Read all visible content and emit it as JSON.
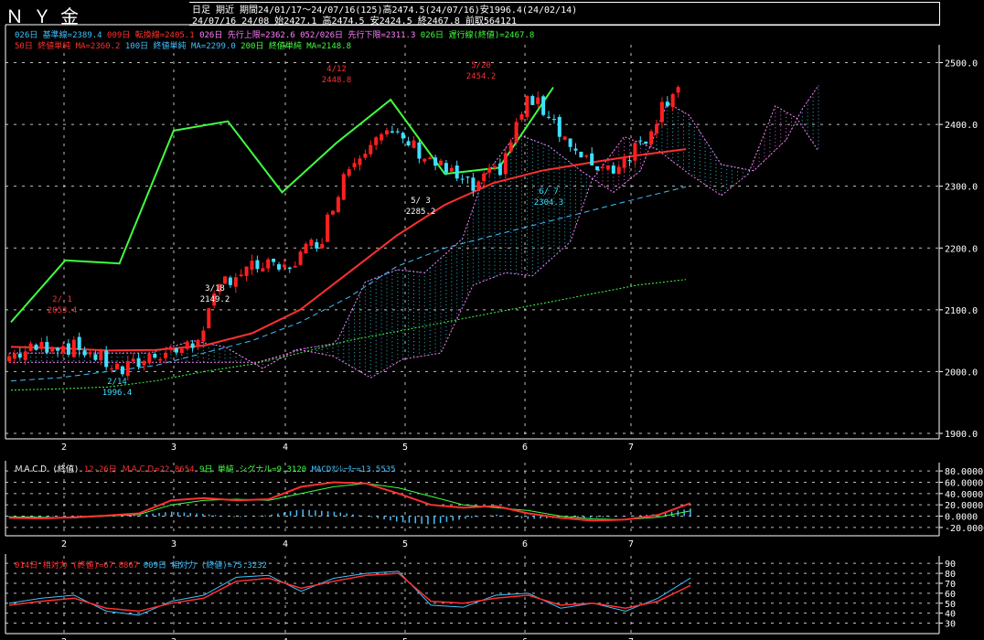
{
  "header": {
    "title": "ＮＹ金",
    "line1": "日足 期近 期間24/01/17～24/07/16(125)高2474.5(24/07/16)安1996.4(24/02/14)",
    "line2": "24/07/16 24/08 始2427.1 高2474.5 安2424.5 終2467.8 前取564121"
  },
  "legend": {
    "row1": [
      {
        "text": "026日 基準線=2389.4",
        "color": "#40c0ff"
      },
      {
        "text": "009日 転換線=2405.1",
        "color": "#ff3030"
      },
      {
        "text": "026日 先行上限=2362.6",
        "color": "#ff80ff"
      },
      {
        "text": "052/026日 先行下限=2311.3",
        "color": "#ff80ff"
      },
      {
        "text": "026日 遅行線(終値)=2467.8",
        "color": "#40ff40"
      }
    ],
    "row2": [
      {
        "text": "50日 終値単純 MA=2360.2",
        "color": "#ff3030"
      },
      {
        "text": "100日 終値単純 MA=2299.0",
        "color": "#40c0ff"
      },
      {
        "text": "200日 終値単純 MA=2148.8",
        "color": "#40ff40"
      }
    ],
    "macd": [
      {
        "text": "ＭＡＣＤ (終値)",
        "color": "#ffffff"
      },
      {
        "text": "12-26日 ＭＡＣＤ=22.8654",
        "color": "#ff3030"
      },
      {
        "text": "9日 単純 シグナル=9.3120",
        "color": "#40ff40"
      },
      {
        "text": "MACDｵｼﾚｰﾀｰ=13.5535",
        "color": "#40c0ff"
      }
    ],
    "rsi": [
      {
        "text": "014日 相対力 (終値)=67.8867",
        "color": "#ff3030"
      },
      {
        "text": "009日 相対力 (終値)=75.3232",
        "color": "#40c0ff"
      }
    ]
  },
  "colors": {
    "up": "#ff2020",
    "down": "#40e0ff",
    "grid": "#ffffff",
    "text": "#ffffff"
  },
  "chart_data": [
    {
      "type": "candlestick",
      "title": "ＮＹ金",
      "x_ticks": [
        "2",
        "3",
        "4",
        "5",
        "6",
        "7"
      ],
      "ylim": [
        1900,
        2520
      ],
      "y_ticks": [
        "1900.0",
        "2000.0",
        "2100.0",
        "2200.0",
        "2300.0",
        "2400.0",
        "2500.0"
      ],
      "grid": true,
      "series": [
        {
          "name": "50日 終値単純 MA",
          "values": [
            2040,
            2038,
            2034,
            2035,
            2042,
            2062,
            2100,
            2160,
            2220,
            2270,
            2305,
            2325,
            2338,
            2350,
            2360
          ]
        },
        {
          "name": "100日 終値単純 MA",
          "values": [
            1985,
            1990,
            2000,
            2010,
            2030,
            2050,
            2080,
            2120,
            2170,
            2200,
            2220,
            2240,
            2260,
            2280,
            2299
          ]
        },
        {
          "name": "200日 終値単純 MA",
          "values": [
            1970,
            1972,
            1975,
            1985,
            2000,
            2012,
            2030,
            2050,
            2065,
            2080,
            2095,
            2110,
            2125,
            2140,
            2149
          ]
        },
        {
          "name": "026日 遅行線(終値)",
          "values": [
            2080,
            2180,
            2175,
            2390,
            2405,
            2290,
            2370,
            2440,
            2320,
            2330,
            2460
          ]
        }
      ],
      "annotations": [
        {
          "label": "2/ 1",
          "value": "2053.4"
        },
        {
          "label": "2/14",
          "value": "1996.4"
        },
        {
          "label": "3/18",
          "value": "2149.2"
        },
        {
          "label": "4/12",
          "value": "2448.8"
        },
        {
          "label": "5/ 3",
          "value": "2285.2"
        },
        {
          "label": "5/20",
          "value": "2454.2"
        },
        {
          "label": "6/ 7",
          "value": "2304.3"
        }
      ]
    },
    {
      "type": "line",
      "title": "ＭＡＣＤ (終値)",
      "ylim": [
        -25,
        85
      ],
      "y_ticks": [
        "-20.0000",
        "0.0000",
        "20.0000",
        "40.0000",
        "60.0000",
        "80.0000"
      ],
      "series": [
        {
          "name": "12-26日 ＭＡＣＤ",
          "values": [
            -3,
            -4,
            -2,
            1,
            5,
            28,
            32,
            28,
            30,
            52,
            60,
            58,
            40,
            20,
            15,
            18,
            5,
            -3,
            -8,
            -6,
            2,
            22.87
          ]
        },
        {
          "name": "9日 単純 シグナル",
          "values": [
            -1,
            -2,
            -3,
            0,
            3,
            20,
            28,
            30,
            28,
            40,
            52,
            58,
            50,
            35,
            20,
            15,
            10,
            0,
            -5,
            -6,
            -2,
            9.31
          ]
        },
        {
          "name": "MACDｵｼﾚｰﾀｰ",
          "values": [
            -2,
            -2,
            1,
            1,
            2,
            8,
            4,
            -2,
            2,
            12,
            8,
            0,
            -10,
            -15,
            -5,
            3,
            -5,
            -3,
            -3,
            0,
            4,
            13.55
          ]
        }
      ]
    },
    {
      "type": "line",
      "title": "相対力",
      "ylim": [
        25,
        92
      ],
      "y_ticks": [
        "30",
        "40",
        "50",
        "60",
        "70",
        "80",
        "90"
      ],
      "series": [
        {
          "name": "014日 相対力 (終値)",
          "values": [
            48,
            52,
            55,
            45,
            42,
            50,
            55,
            72,
            75,
            65,
            72,
            78,
            80,
            52,
            50,
            55,
            58,
            48,
            50,
            45,
            52,
            67.89
          ]
        },
        {
          "name": "009日 相対力 (終値)",
          "values": [
            50,
            55,
            58,
            42,
            38,
            52,
            58,
            76,
            78,
            62,
            75,
            80,
            82,
            48,
            46,
            58,
            60,
            45,
            50,
            42,
            55,
            75.32
          ]
        }
      ]
    }
  ]
}
